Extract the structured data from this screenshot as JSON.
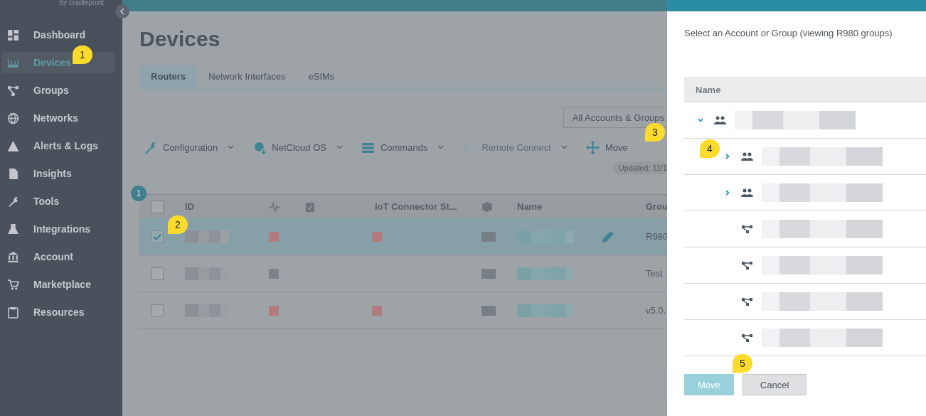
{
  "brand": {
    "text": "by cradlepoint"
  },
  "sidebar": {
    "items": [
      {
        "label": "Dashboard",
        "selected": false
      },
      {
        "label": "Devices",
        "selected": true
      },
      {
        "label": "Groups",
        "selected": false
      },
      {
        "label": "Networks",
        "selected": false
      },
      {
        "label": "Alerts & Logs",
        "selected": false
      },
      {
        "label": "Insights",
        "selected": false
      },
      {
        "label": "Tools",
        "selected": false
      },
      {
        "label": "Integrations",
        "selected": false
      },
      {
        "label": "Account",
        "selected": false
      },
      {
        "label": "Marketplace",
        "selected": false
      },
      {
        "label": "Resources",
        "selected": false
      }
    ]
  },
  "page": {
    "title": "Devices",
    "tabs": [
      {
        "label": "Routers",
        "selected": true
      },
      {
        "label": "Network Interfaces",
        "selected": false
      },
      {
        "label": "eSIMs",
        "selected": false
      }
    ],
    "scope_dropdown": {
      "value": "All Accounts & Groups"
    },
    "toolbar": [
      {
        "label": "Configuration",
        "disabled": false,
        "caret": true
      },
      {
        "label": "NetCloud OS",
        "disabled": false,
        "caret": true
      },
      {
        "label": "Commands",
        "disabled": false,
        "caret": true
      },
      {
        "label": "Remote Connect",
        "disabled": true,
        "caret": true
      },
      {
        "label": "Move",
        "disabled": false,
        "caret": false
      }
    ],
    "updated": "Updated: 11/1",
    "selected_count": "1",
    "table": {
      "all_selected": false,
      "columns": [
        {
          "kind": "checkbox"
        },
        {
          "kind": "text",
          "label": "ID"
        },
        {
          "kind": "icon"
        },
        {
          "kind": "icon"
        },
        {
          "kind": "text",
          "label": "IoT Connector St..."
        },
        {
          "kind": "icon"
        },
        {
          "kind": "text",
          "label": "Name"
        },
        {
          "kind": "blank"
        },
        {
          "kind": "text",
          "label": "Grou"
        }
      ],
      "rows": [
        {
          "selected": true,
          "status": {
            "color": "#b27b7d"
          },
          "iot": {
            "color": "#b27b7d"
          },
          "editable": true,
          "group": "R980"
        },
        {
          "selected": false,
          "status": {
            "color": "#7d8288"
          },
          "editable": false,
          "group": "Test"
        },
        {
          "selected": false,
          "status": {
            "color": "#b27b7d"
          },
          "iot": {
            "color": "#b27b7d"
          },
          "editable": false,
          "group": "v5.0."
        }
      ]
    }
  },
  "drawer": {
    "title": "Select an Account or Group (viewing R980 groups)",
    "column": "Name",
    "tree": [
      {
        "kind": "account",
        "expanded": true,
        "children": [
          {
            "kind": "account",
            "expanded": false
          },
          {
            "kind": "account",
            "expanded": false
          },
          {
            "kind": "group"
          },
          {
            "kind": "group"
          },
          {
            "kind": "group"
          },
          {
            "kind": "group"
          }
        ]
      }
    ],
    "buttons": [
      {
        "label": "Move",
        "kind": "primary",
        "disabled": true
      },
      {
        "label": "Cancel",
        "kind": "secondary"
      }
    ]
  },
  "callouts": [
    "1",
    "2",
    "3",
    "4",
    "5"
  ]
}
